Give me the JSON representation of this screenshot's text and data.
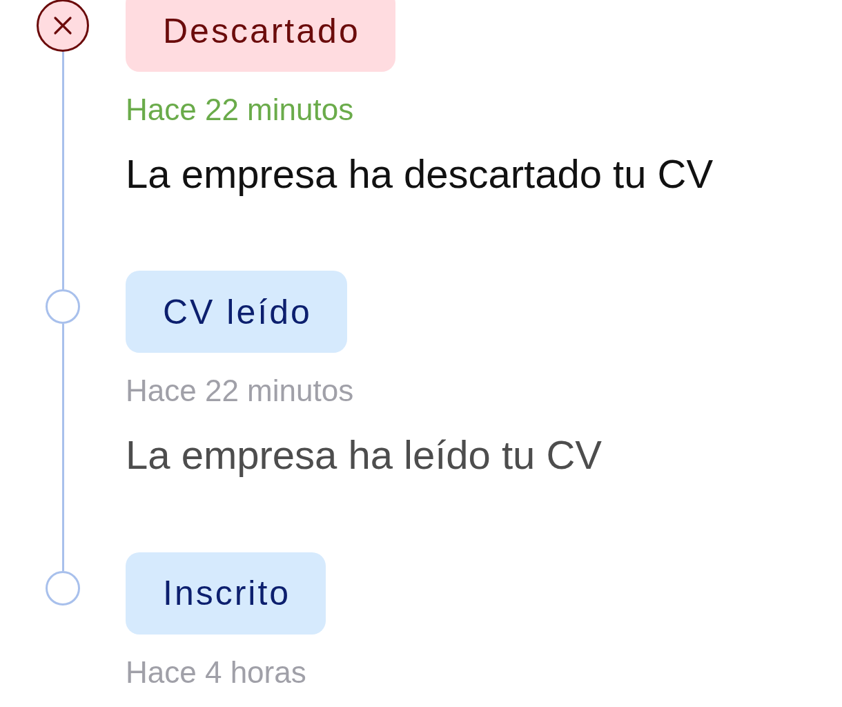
{
  "events": [
    {
      "kind": "rejected",
      "latest": true,
      "status": "Descartado",
      "time": "Hace 22 minutos",
      "description": "La empresa ha descartado tu CV"
    },
    {
      "kind": "step",
      "latest": false,
      "status": "CV leído",
      "time": "Hace 22 minutos",
      "description": "La empresa ha leído tu CV"
    },
    {
      "kind": "step",
      "latest": false,
      "status": "Inscrito",
      "time": "Hace 4 horas"
    }
  ]
}
